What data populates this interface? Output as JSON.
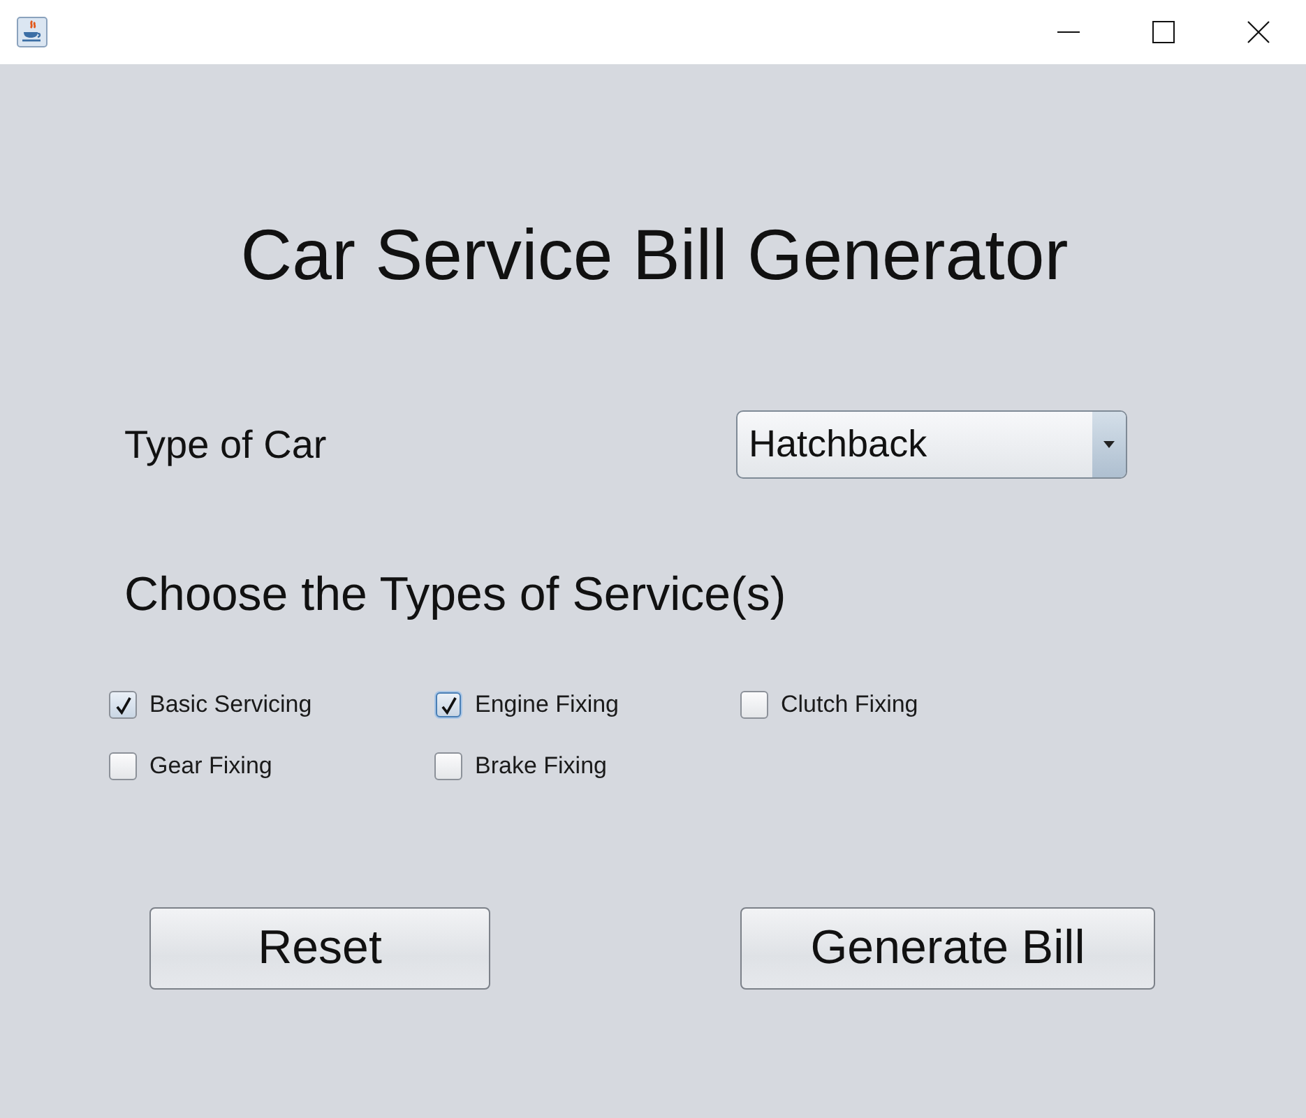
{
  "title": "Car Service Bill Generator",
  "car_type": {
    "label": "Type of Car",
    "value": "Hatchback"
  },
  "services": {
    "heading": "Choose the Types of Service(s)",
    "options": [
      {
        "label": "Basic Servicing",
        "checked": true,
        "focused": false
      },
      {
        "label": "Engine Fixing",
        "checked": true,
        "focused": true
      },
      {
        "label": "Clutch Fixing",
        "checked": false,
        "focused": false
      },
      {
        "label": "Gear Fixing",
        "checked": false,
        "focused": false
      },
      {
        "label": "Brake Fixing",
        "checked": false,
        "focused": false
      }
    ]
  },
  "buttons": [
    {
      "label": "Reset"
    },
    {
      "label": "Generate Bill"
    }
  ]
}
